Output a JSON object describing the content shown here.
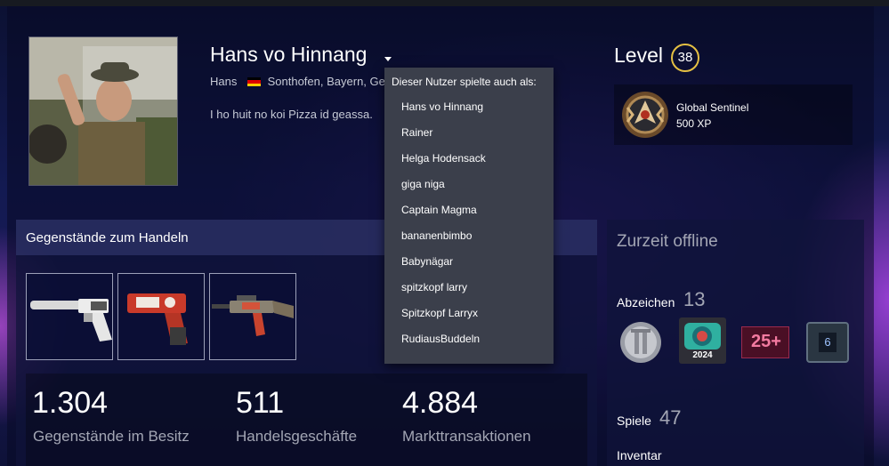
{
  "profile": {
    "persona_name": "Hans vo Hinnang",
    "real_name": "Hans",
    "location": "Sonthofen, Bayern, Ge",
    "summary": "I ho huit no koi Pizza id geassa."
  },
  "name_history": {
    "title": "Dieser Nutzer spielte auch als:",
    "names": [
      "Hans vo Hinnang",
      "Rainer",
      "Helga Hodensack",
      "giga niga",
      "Captain Magma",
      "bananenbimbo",
      "Babynägar",
      "spitzkopf larry",
      "Spitzkopf Larryx",
      "RudiausBuddeln"
    ]
  },
  "level": {
    "label": "Level",
    "value": "38",
    "badge_color": "#e5c043",
    "featured_badge": {
      "name": "Global Sentinel",
      "xp": "500 XP",
      "icon": "global-sentinel-badge-icon"
    }
  },
  "trade": {
    "title": "Gegenstände zum Handeln",
    "items": [
      {
        "icon": "usp-s-pistol-icon"
      },
      {
        "icon": "red-pistol-icon"
      },
      {
        "icon": "rifle-icon"
      }
    ],
    "stats": [
      {
        "value": "1.304",
        "label": "Gegenstände im Besitz"
      },
      {
        "value": "511",
        "label": "Handelsgeschäfte"
      },
      {
        "value": "4.884",
        "label": "Markttransaktionen"
      }
    ]
  },
  "sidebar": {
    "status": "Zurzeit offline",
    "badges": {
      "label": "Abzeichen",
      "count": "13",
      "year_badge_text": "2024",
      "years_badge_text": "25+",
      "number_badge_text": "6"
    },
    "games": {
      "label": "Spiele",
      "count": "47"
    },
    "inventory": {
      "label": "Inventar"
    }
  }
}
